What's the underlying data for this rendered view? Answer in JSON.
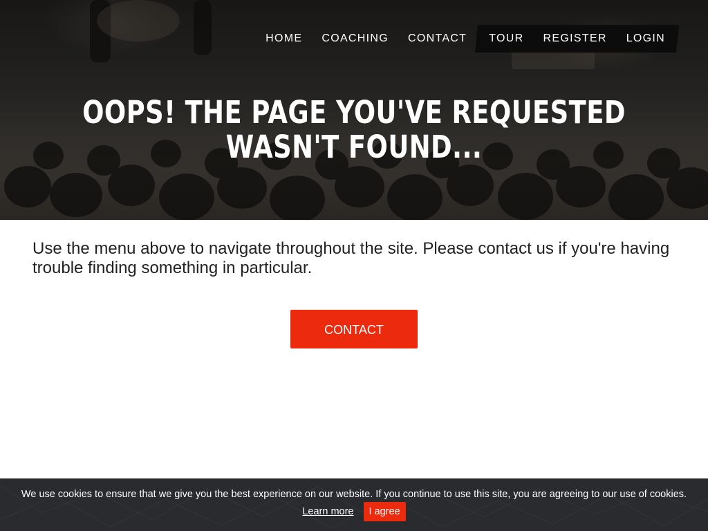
{
  "nav": {
    "items": [
      {
        "label": "HOME"
      },
      {
        "label": "COACHING"
      },
      {
        "label": "CONTACT"
      },
      {
        "label": "TOUR"
      },
      {
        "label": "REGISTER"
      },
      {
        "label": "LOGIN"
      }
    ]
  },
  "hero": {
    "title": "OOPS! THE PAGE YOU'VE REQUESTED WASN'T FOUND..."
  },
  "main": {
    "message": "Use the menu above to navigate throughout the site. Please contact us if you're having trouble finding something in particular.",
    "contact_button": "CONTACT"
  },
  "cookie": {
    "text": "We use cookies to ensure that we give you the best experience on our website. If you continue to use this site, you are agreeing to our use of cookies.",
    "learn_more": "Learn more",
    "agree": "I agree"
  },
  "colors": {
    "accent": "#ec2a0d",
    "cookie_bg": "#2a2b2f",
    "nav_highlight_bg": "#0c0c0c"
  }
}
